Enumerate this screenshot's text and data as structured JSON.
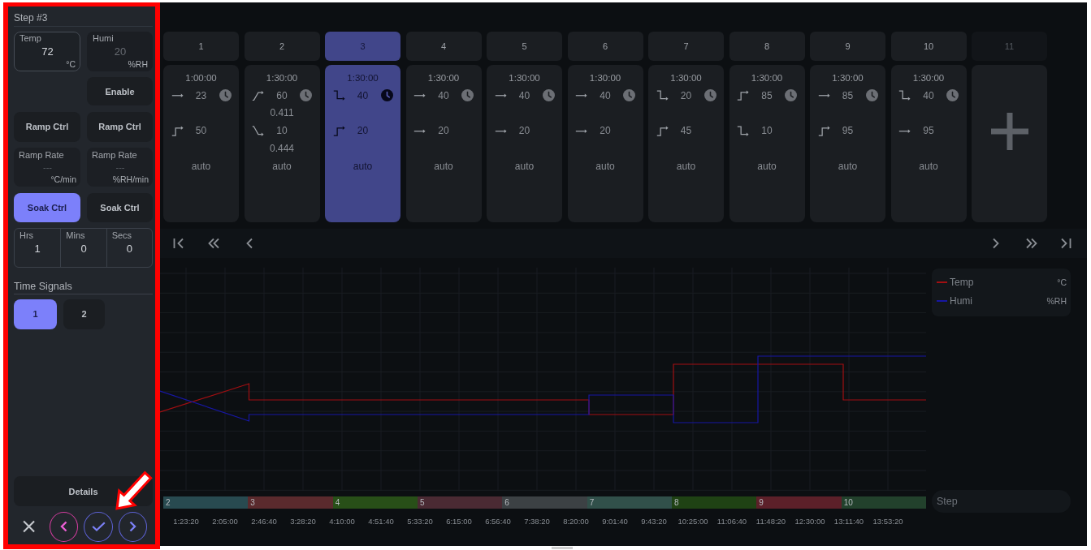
{
  "sidebar": {
    "title": "Step #3",
    "setpoints": [
      {
        "label": "Temp",
        "value": "72",
        "unit": "°C",
        "disabled": false
      },
      {
        "label": "Humi",
        "value": "20",
        "unit": "%RH",
        "disabled": true
      }
    ],
    "enable_button": "Enable",
    "ramp_ctrl": [
      {
        "label": "Ramp Ctrl",
        "selected": false
      },
      {
        "label": "Ramp Ctrl",
        "selected": false
      }
    ],
    "ramp_rate": [
      {
        "label": "Ramp Rate",
        "placeholder": "---",
        "unit": "°C/min"
      },
      {
        "label": "Ramp Rate",
        "placeholder": "---",
        "unit": "%RH/min"
      }
    ],
    "soak_ctrl": [
      {
        "label": "Soak Ctrl",
        "selected": true
      },
      {
        "label": "Soak Ctrl",
        "selected": false
      }
    ],
    "soak_time": [
      {
        "label": "Hrs",
        "value": "1"
      },
      {
        "label": "Mins",
        "value": "0"
      },
      {
        "label": "Secs",
        "value": "0"
      }
    ],
    "time_signals": {
      "title": "Time Signals",
      "items": [
        {
          "label": "1",
          "selected": true
        },
        {
          "label": "2",
          "selected": false
        }
      ]
    },
    "details_button": "Details"
  },
  "steps": [
    {
      "label": "1",
      "selected": false,
      "duration": "1:00:00",
      "temp": {
        "kind": "hold",
        "value": "23"
      },
      "humi": {
        "kind": "step_up",
        "value": "50"
      },
      "control": "auto"
    },
    {
      "label": "2",
      "selected": false,
      "duration": "1:30:00",
      "temp": {
        "kind": "ramp_up",
        "value": "60",
        "rate": "0.411"
      },
      "humi": {
        "kind": "ramp_down",
        "value": "10",
        "rate": "0.444"
      },
      "control": "auto"
    },
    {
      "label": "3",
      "selected": true,
      "duration": "1:30:00",
      "temp": {
        "kind": "step_down",
        "value": "40"
      },
      "humi": {
        "kind": "step_up",
        "value": "20"
      },
      "control": "auto"
    },
    {
      "label": "4",
      "selected": false,
      "duration": "1:30:00",
      "temp": {
        "kind": "hold",
        "value": "40"
      },
      "humi": {
        "kind": "hold",
        "value": "20"
      },
      "control": "auto"
    },
    {
      "label": "5",
      "selected": false,
      "duration": "1:30:00",
      "temp": {
        "kind": "hold",
        "value": "40"
      },
      "humi": {
        "kind": "hold",
        "value": "20"
      },
      "control": "auto"
    },
    {
      "label": "6",
      "selected": false,
      "duration": "1:30:00",
      "temp": {
        "kind": "hold",
        "value": "40"
      },
      "humi": {
        "kind": "hold",
        "value": "20"
      },
      "control": "auto"
    },
    {
      "label": "7",
      "selected": false,
      "duration": "1:30:00",
      "temp": {
        "kind": "step_down",
        "value": "20"
      },
      "humi": {
        "kind": "step_up",
        "value": "45"
      },
      "control": "auto"
    },
    {
      "label": "8",
      "selected": false,
      "duration": "1:30:00",
      "temp": {
        "kind": "step_up",
        "value": "85"
      },
      "humi": {
        "kind": "step_down",
        "value": "10"
      },
      "control": "auto"
    },
    {
      "label": "9",
      "selected": false,
      "duration": "1:30:00",
      "temp": {
        "kind": "hold",
        "value": "85"
      },
      "humi": {
        "kind": "step_up",
        "value": "95"
      },
      "control": "auto"
    },
    {
      "label": "10",
      "selected": false,
      "duration": "1:30:00",
      "temp": {
        "kind": "step_down",
        "value": "40"
      },
      "humi": {
        "kind": "hold",
        "value": "95"
      },
      "control": "auto"
    }
  ],
  "new_step": {
    "label": "11",
    "disabled": true
  },
  "chart": {
    "legend": [
      {
        "name": "Temp",
        "unit": "°C",
        "color": "#a10f12"
      },
      {
        "name": "Humi",
        "unit": "%RH",
        "color": "#1717a3"
      }
    ],
    "step_band": [
      {
        "label": "2",
        "color": "#284a50"
      },
      {
        "label": "3",
        "color": "#5a2a2d"
      },
      {
        "label": "4",
        "color": "#284f18"
      },
      {
        "label": "5",
        "color": "#4a2a33"
      },
      {
        "label": "6",
        "color": "#3c4144"
      },
      {
        "label": "7",
        "color": "#31504a"
      },
      {
        "label": "8",
        "color": "#1f4214"
      },
      {
        "label": "9",
        "color": "#5c2029"
      },
      {
        "label": "10",
        "color": "#22412c"
      }
    ],
    "step_legend": "Step",
    "time_labels": [
      "1:23:20",
      "2:05:00",
      "2:46:40",
      "3:28:20",
      "4:10:00",
      "4:51:40",
      "5:33:20",
      "6:15:00",
      "6:56:40",
      "7:38:20",
      "8:20:00",
      "9:01:40",
      "9:43:20",
      "10:25:00",
      "11:06:40",
      "11:48:20",
      "12:30:00",
      "13:11:40",
      "13:53:20"
    ]
  }
}
